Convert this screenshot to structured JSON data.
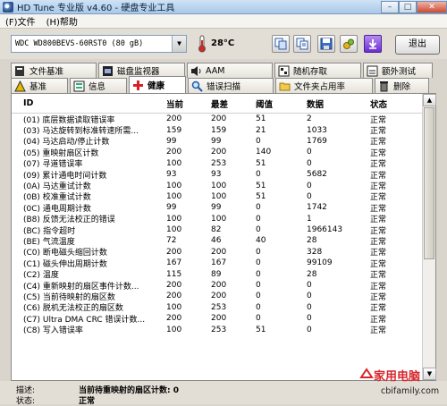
{
  "window": {
    "title": "HD Tune 专业版 v4.60 - 硬盘专业工具",
    "buttons": {
      "minimize": "–",
      "maximize": "□",
      "close": "✕"
    }
  },
  "menu": {
    "file": "(F)文件",
    "help": "(H)帮助"
  },
  "toolbar": {
    "drive": "WDC WD800BEVS-60RST0 (80 gB)",
    "temperature": "28°C",
    "exit": "退出",
    "icons": [
      "copy-icon",
      "copy-text-icon",
      "save-icon",
      "settings-icon",
      "download-icon"
    ]
  },
  "tabs": {
    "row1": [
      {
        "label": "文件基准",
        "icon": "file-benchmark-icon"
      },
      {
        "label": "磁盘监视器",
        "icon": "disk-monitor-icon"
      },
      {
        "label": "AAM",
        "icon": "speaker-icon"
      },
      {
        "label": "随机存取",
        "icon": "random-access-icon"
      },
      {
        "label": "额外测试",
        "icon": "extra-tests-icon"
      }
    ],
    "row2": [
      {
        "label": "基准",
        "icon": "benchmark-icon"
      },
      {
        "label": "信息",
        "icon": "info-icon"
      },
      {
        "label": "健康",
        "icon": "health-icon"
      },
      {
        "label": "错误扫描",
        "icon": "error-scan-icon"
      },
      {
        "label": "文件夹占用率",
        "icon": "folder-usage-icon"
      },
      {
        "label": "删除",
        "icon": "erase-icon"
      }
    ],
    "active": "健康"
  },
  "health_table": {
    "columns": [
      "ID",
      "当前",
      "最差",
      "阈值",
      "数据",
      "状态"
    ],
    "rows": [
      {
        "id": "(01) 底层数据读取错误率",
        "current": "200",
        "worst": "200",
        "threshold": "51",
        "data": "2",
        "status": "正常"
      },
      {
        "id": "(03) 马达旋转到标准转速所需...",
        "current": "159",
        "worst": "159",
        "threshold": "21",
        "data": "1033",
        "status": "正常"
      },
      {
        "id": "(04) 马达启动/停止计数",
        "current": "99",
        "worst": "99",
        "threshold": "0",
        "data": "1769",
        "status": "正常"
      },
      {
        "id": "(05) 重映射扇区计数",
        "current": "200",
        "worst": "200",
        "threshold": "140",
        "data": "0",
        "status": "正常"
      },
      {
        "id": "(07) 寻道错误率",
        "current": "100",
        "worst": "253",
        "threshold": "51",
        "data": "0",
        "status": "正常"
      },
      {
        "id": "(09) 累计通电时间计数",
        "current": "93",
        "worst": "93",
        "threshold": "0",
        "data": "5682",
        "status": "正常"
      },
      {
        "id": "(0A) 马达重试计数",
        "current": "100",
        "worst": "100",
        "threshold": "51",
        "data": "0",
        "status": "正常"
      },
      {
        "id": "(0B) 校准重试计数",
        "current": "100",
        "worst": "100",
        "threshold": "51",
        "data": "0",
        "status": "正常"
      },
      {
        "id": "(0C) 通电周期计数",
        "current": "99",
        "worst": "99",
        "threshold": "0",
        "data": "1742",
        "status": "正常"
      },
      {
        "id": "(B8) 反馈无法校正的错误",
        "current": "100",
        "worst": "100",
        "threshold": "0",
        "data": "1",
        "status": "正常"
      },
      {
        "id": "(BC) 指令超时",
        "current": "100",
        "worst": "82",
        "threshold": "0",
        "data": "1966143",
        "status": "正常"
      },
      {
        "id": "(BE) 气流温度",
        "current": "72",
        "worst": "46",
        "threshold": "40",
        "data": "28",
        "status": "正常"
      },
      {
        "id": "(C0) 断电磁头缩回计数",
        "current": "200",
        "worst": "200",
        "threshold": "0",
        "data": "328",
        "status": "正常"
      },
      {
        "id": "(C1) 磁头伸出周期计数",
        "current": "167",
        "worst": "167",
        "threshold": "0",
        "data": "99109",
        "status": "正常"
      },
      {
        "id": "(C2) 温度",
        "current": "115",
        "worst": "89",
        "threshold": "0",
        "data": "28",
        "status": "正常"
      },
      {
        "id": "(C4) 重新映射的扇区事件计数...",
        "current": "200",
        "worst": "200",
        "threshold": "0",
        "data": "0",
        "status": "正常"
      },
      {
        "id": "(C5) 当前待映射的扇区数",
        "current": "200",
        "worst": "200",
        "threshold": "0",
        "data": "0",
        "status": "正常"
      },
      {
        "id": "(C6) 脱机无法校正的扇区数",
        "current": "100",
        "worst": "253",
        "threshold": "0",
        "data": "0",
        "status": "正常"
      },
      {
        "id": "(C7) Ultra DMA CRC 错误计数...",
        "current": "200",
        "worst": "200",
        "threshold": "0",
        "data": "0",
        "status": "正常"
      },
      {
        "id": "(C8) 写入错误率",
        "current": "100",
        "worst": "253",
        "threshold": "51",
        "data": "0",
        "status": "正常"
      }
    ]
  },
  "footer": {
    "desc_label": "描述:",
    "desc_value": "当前待重映射的扇区计数: 0",
    "status_label": "状态:",
    "status_value": "正常"
  },
  "watermark": {
    "brand": "家用电脑",
    "url": "cbifamily.com"
  }
}
